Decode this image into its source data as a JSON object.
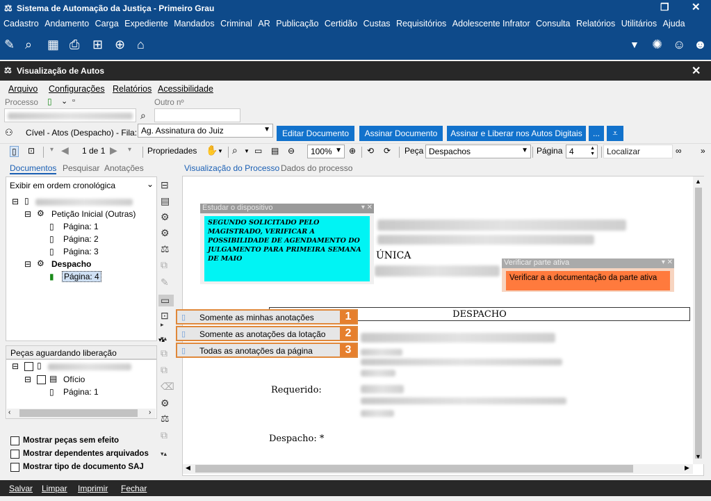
{
  "app_title": "Sistema de Automação da Justiça - Primeiro Grau",
  "app_menu": [
    "Cadastro",
    "Andamento",
    "Carga",
    "Expediente",
    "Mandados",
    "Criminal",
    "AR",
    "Publicação",
    "Certidão",
    "Custas",
    "Requisitórios",
    "Adolescente Infrator",
    "Consulta",
    "Relatórios",
    "Utilitários",
    "Ajuda"
  ],
  "modal_title": "Visualização de Autos",
  "modal_menu": [
    "Arquivo",
    "Configurações",
    "Relatórios",
    "Acessibilidade"
  ],
  "processo_label": "Processo",
  "outro_label": "Outro nº",
  "fila_text": "Cível - Atos (Despacho) - Fila:",
  "fila_value": "Ag. Assinatura do Juiz",
  "buttons": {
    "editar": "Editar Documento",
    "assinar": "Assinar Documento",
    "liberar": "Assinar e Liberar nos Autos Digitais",
    "more": "..."
  },
  "toolbar": {
    "page_count": "1 de 1",
    "propriedades": "Propriedades",
    "zoom": "100%",
    "peca_label": "Peça",
    "peca_value": "Despachos",
    "pagina_label": "Página",
    "pagina_value": "4",
    "localizar_placeholder": "Localizar"
  },
  "left_tabs": [
    "Documentos",
    "Pesquisar",
    "Anotações"
  ],
  "view_tabs": [
    "Visualização do Processo",
    "Dados do processo"
  ],
  "order_select": "Exibir em ordem cronológica",
  "tree": {
    "peticao": "Petição Inicial (Outras)",
    "pag1": "Página: 1",
    "pag2": "Página: 2",
    "pag3": "Página: 3",
    "despacho": "Despacho",
    "pag4": "Página: 4"
  },
  "pecas_header": "Peças aguardando liberação",
  "pecas_tree": {
    "oficio": "Ofício",
    "pag1": "Página: 1"
  },
  "checkboxes": [
    "Mostrar peças sem efeito",
    "Mostrar dependentes arquivados",
    "Mostrar tipo de documento SAJ"
  ],
  "note1": {
    "title": "Estudar o dispositivo",
    "text": "SEGUNDO SOLICITADO PELO MAGISTRADO, VERIFICAR A POSSIBILIDADE DE AGENDAMENTO DO JULGAMENTO PARA PRIMEIRA SEMANA DE MAIO"
  },
  "note2": {
    "title": "Verificar parte ativa",
    "text": "Verificar a a documentação da parte ativa"
  },
  "doc": {
    "unica": "ÚNICA",
    "despacho_header": "DESPACHO",
    "requerido": "Requerido:",
    "despacho_label": "Despacho: *"
  },
  "context_menu": [
    {
      "label": "Somente as minhas anotações",
      "num": "1"
    },
    {
      "label": "Somente as anotações da lotação",
      "num": "2"
    },
    {
      "label": "Todas as anotações da página",
      "num": "3"
    }
  ],
  "bottom": [
    "Salvar",
    "Limpar",
    "Imprimir",
    "Fechar"
  ],
  "colors": {
    "titlebar": "#0e4a8a",
    "accent": "#1272cc",
    "note_cyan": "#00f4f4",
    "note_orange": "#ff7a3d",
    "callout": "#e67f2d"
  }
}
